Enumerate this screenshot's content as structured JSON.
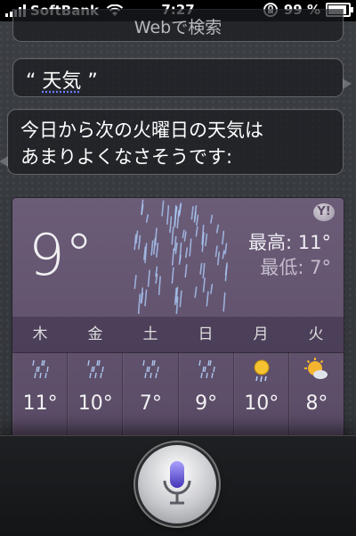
{
  "status_bar": {
    "carrier": "SoftBank",
    "time": "7:27",
    "battery": "99 %",
    "battery_level": 0.99
  },
  "conversation": {
    "previous_bubble": "Webで検索",
    "user_query": "天気",
    "quote_open": "“",
    "quote_close": "”",
    "siri_line1": "今日から次の火曜日の天気は",
    "siri_line2": "あまりよくなさそうです:"
  },
  "weather": {
    "current_temp": "9°",
    "high": "最高: 11°",
    "low": "最低:   7°",
    "provider_icon": "yahoo-logo",
    "days": [
      "木",
      "金",
      "土",
      "日",
      "月",
      "火"
    ],
    "forecast": [
      {
        "icon": "rain-icon",
        "temp": "11°"
      },
      {
        "icon": "rain-icon",
        "temp": "10°"
      },
      {
        "icon": "rain-icon",
        "temp": "7°"
      },
      {
        "icon": "rain-icon",
        "temp": "9°"
      },
      {
        "icon": "sun-rain-icon",
        "temp": "10°"
      },
      {
        "icon": "sun-cloud-icon",
        "temp": "8°"
      }
    ]
  },
  "mic": {
    "icon": "microphone-icon"
  }
}
